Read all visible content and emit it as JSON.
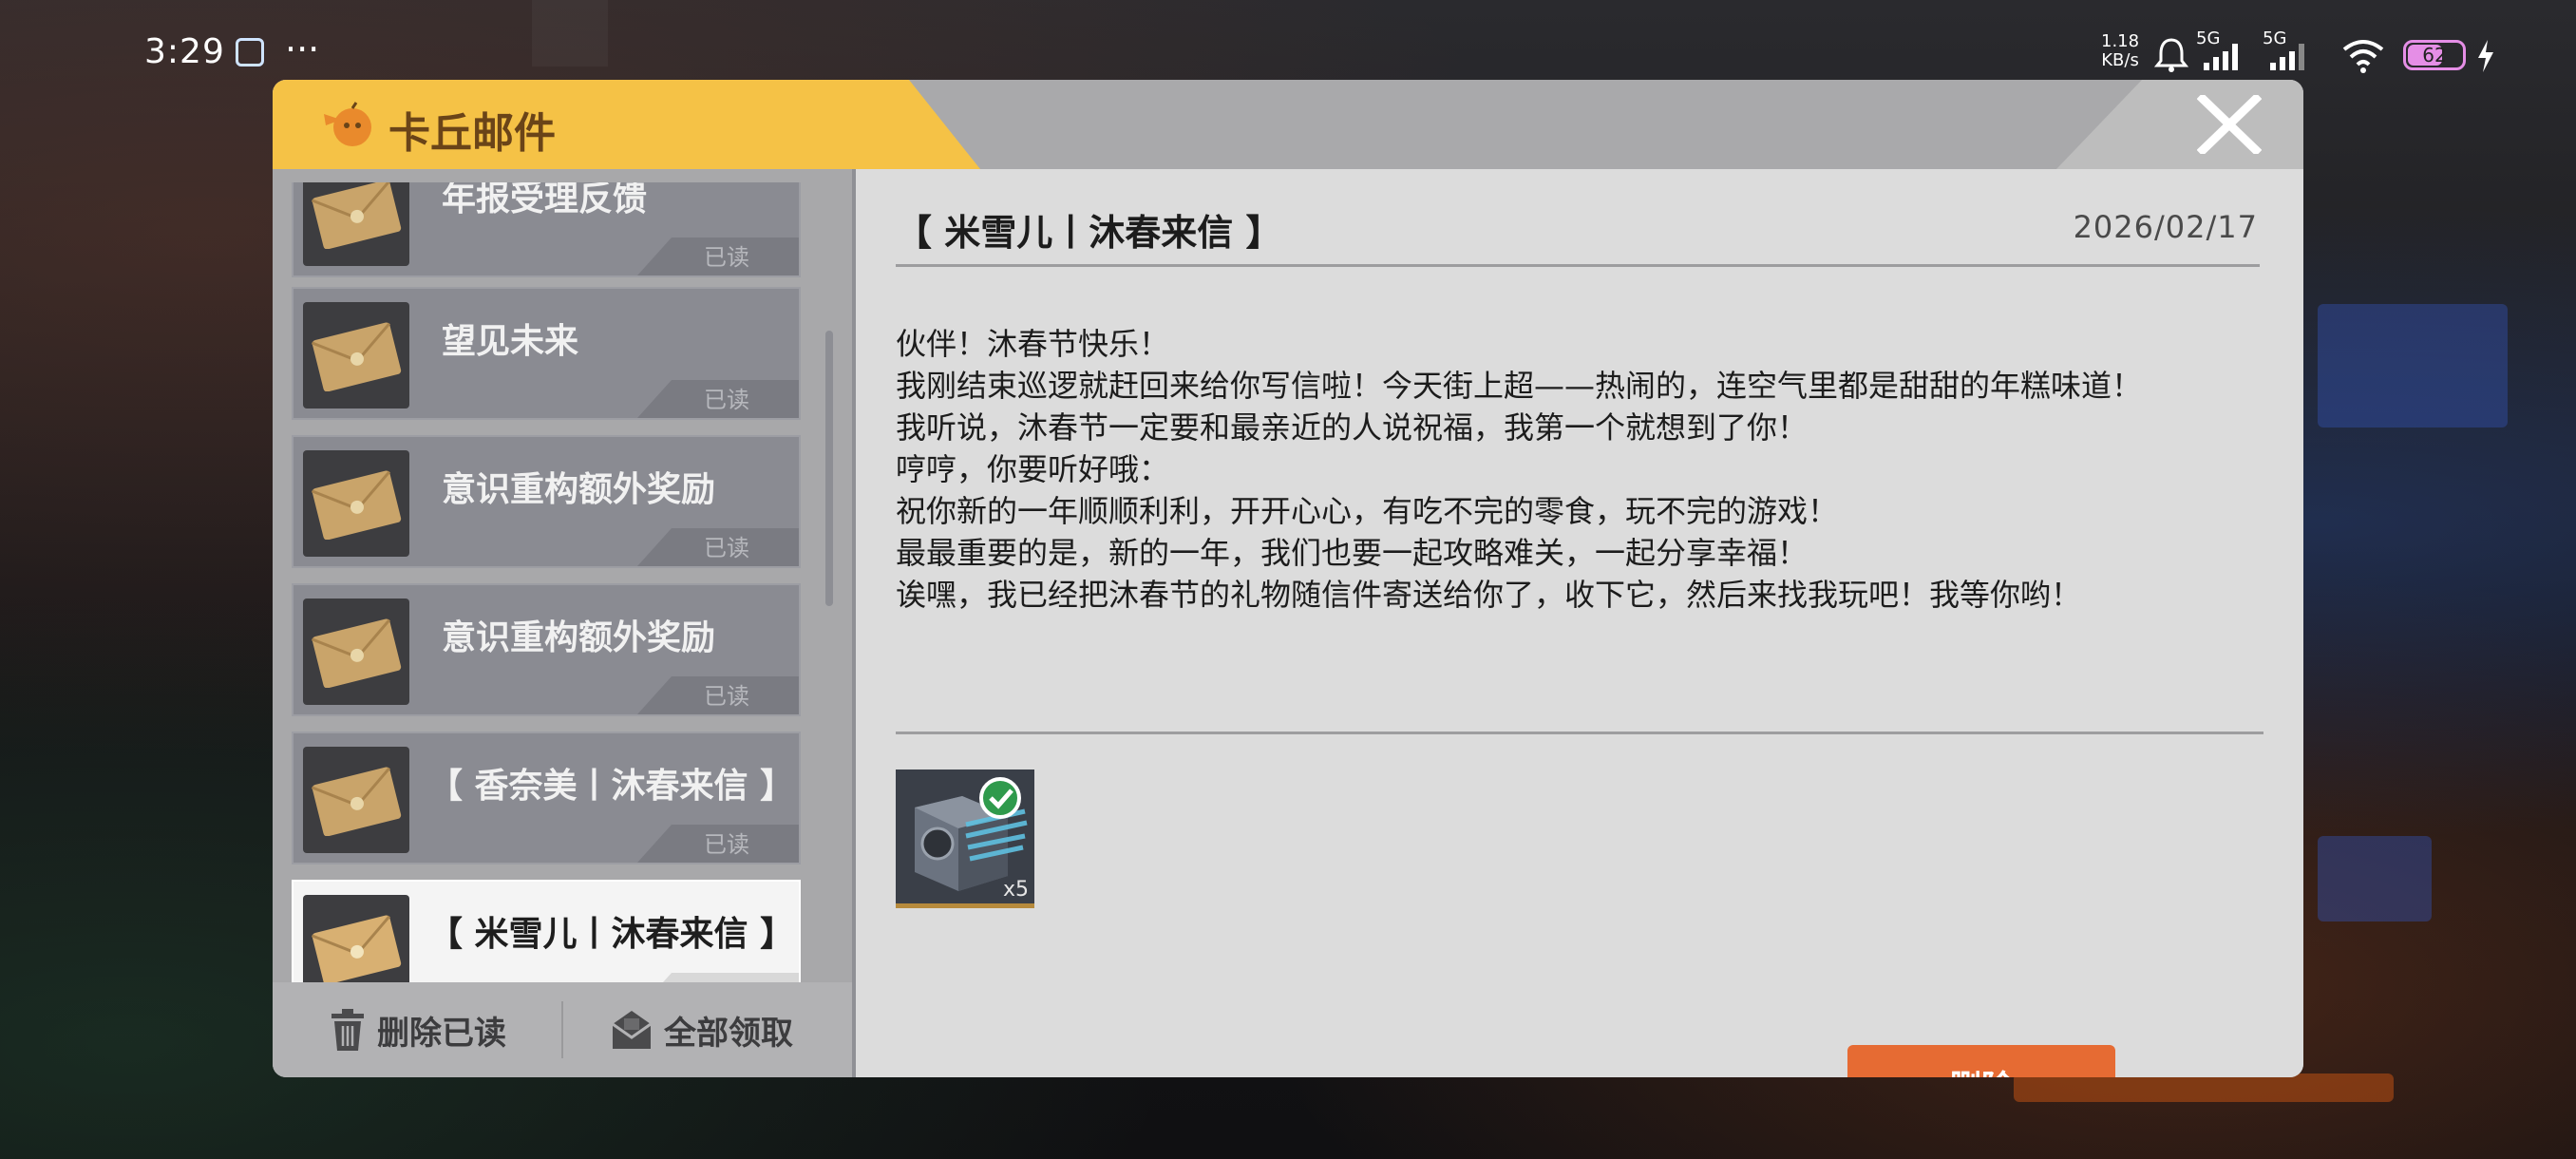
{
  "status_bar": {
    "time": "3:29",
    "more": "···",
    "net_speed_value": "1.18",
    "net_speed_unit": "KB/s",
    "signal1": "5G",
    "signal2": "5G",
    "battery": "62"
  },
  "modal": {
    "title": "卡丘邮件",
    "close_icon": "close-icon"
  },
  "mail_list": {
    "items": [
      {
        "title": "年报受理反馈",
        "status": "已读"
      },
      {
        "title": "望见未来",
        "status": "已读"
      },
      {
        "title": "意识重构额外奖励",
        "status": "已读"
      },
      {
        "title": "意识重构额外奖励",
        "status": "已读"
      },
      {
        "title": "【 香奈美丨沐春来信 】",
        "status": "已读"
      },
      {
        "title": "【 米雪儿丨沐春来信 】",
        "status": ""
      }
    ],
    "selected_index": 5
  },
  "footer": {
    "delete_read": "删除已读",
    "claim_all": "全部领取"
  },
  "mail": {
    "title": "【 米雪儿丨沐春来信 】",
    "date": "2026/02/17",
    "lines": [
      "伙伴！沐春节快乐！",
      "我刚结束巡逻就赶回来给你写信啦！今天街上超——热闹的，连空气里都是甜甜的年糕味道！",
      "我听说，沐春节一定要和最亲近的人说祝福，我第一个就想到了你！",
      "哼哼，你要听好哦：",
      "祝你新的一年顺顺利利，开开心心，有吃不完的零食，玩不完的游戏！",
      "最最重要的是，新的一年，我们也要一起攻略难关，一起分享幸福！",
      "诶嘿，我已经把沐春节的礼物随信件寄送给你了，收下它，然后来找我玩吧！我等你哟！"
    ],
    "attachment": {
      "icon": "device-item-icon",
      "quantity": "x5",
      "claimed": true
    },
    "delete_label": "删除"
  },
  "colors": {
    "title_tab": "#f5c246",
    "delete_button": "#e66b33",
    "panel": "#dcdcdc"
  }
}
